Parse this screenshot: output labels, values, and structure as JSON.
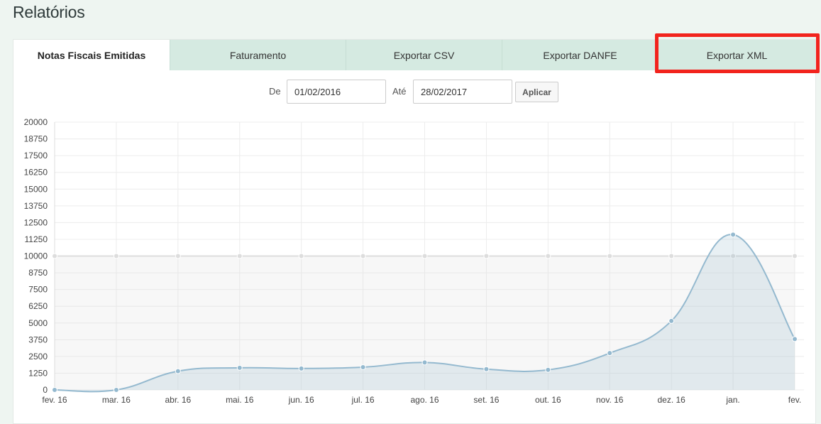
{
  "page": {
    "title": "Relatórios"
  },
  "tabs": [
    {
      "label": "Notas Fiscais Emitidas",
      "active": true
    },
    {
      "label": "Faturamento",
      "active": false
    },
    {
      "label": "Exportar CSV",
      "active": false
    },
    {
      "label": "Exportar DANFE",
      "active": false
    },
    {
      "label": "Exportar XML",
      "active": false,
      "highlighted": true
    }
  ],
  "filter": {
    "from_label": "De",
    "from_value": "01/02/2016",
    "to_label": "Até",
    "to_value": "28/02/2017",
    "apply_label": "Aplicar"
  },
  "colors": {
    "accent_tab": "#d5eae1",
    "highlight": "#f2231d",
    "series_line": "#94b9cf",
    "limit_line": "#dddddd"
  },
  "chart_data": {
    "type": "area",
    "categories": [
      "fev. 16",
      "mar. 16",
      "abr. 16",
      "mai. 16",
      "jun. 16",
      "jul. 16",
      "ago. 16",
      "set. 16",
      "out. 16",
      "nov. 16",
      "dez. 16",
      "jan.",
      "fev."
    ],
    "ylim": [
      0,
      20000
    ],
    "yticks": [
      0,
      1250,
      2500,
      3750,
      5000,
      6250,
      7500,
      8750,
      10000,
      11250,
      12500,
      13750,
      15000,
      16250,
      17500,
      18750,
      20000
    ],
    "grid": true,
    "series": [
      {
        "values": [
          10000,
          10000,
          10000,
          10000,
          10000,
          10000,
          10000,
          10000,
          10000,
          10000,
          10000,
          10000,
          10000
        ],
        "color": "#dddddd"
      },
      {
        "values": [
          0,
          0,
          1400,
          1650,
          1600,
          1700,
          2050,
          1550,
          1500,
          2750,
          5150,
          11600,
          3800
        ],
        "color": "#94b9cf"
      }
    ]
  }
}
